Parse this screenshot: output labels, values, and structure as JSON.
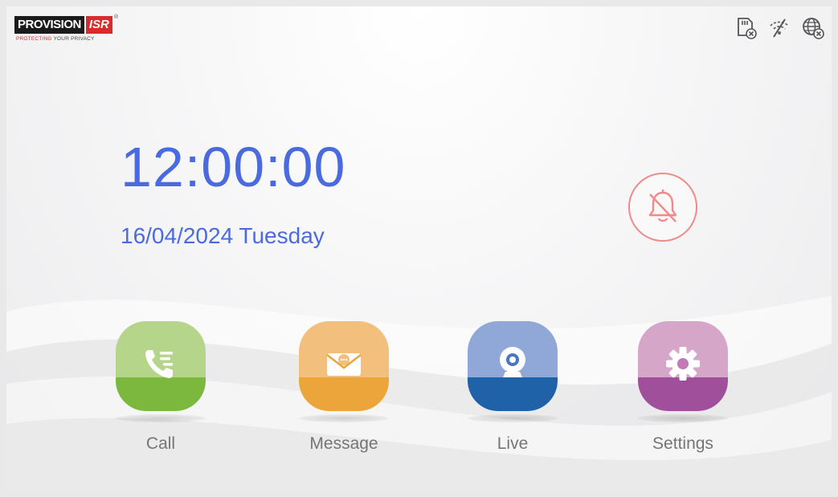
{
  "brand": {
    "name": "PROVISION",
    "suffix": "ISR",
    "registered": "®",
    "tagline_red": "PROTECTING",
    "tagline_dark": "YOUR PRIVACY"
  },
  "status_icons": [
    "sd-card-error-icon",
    "wifi-off-icon",
    "network-error-icon"
  ],
  "clock": {
    "time": "12:00:00",
    "date": "16/04/2024 Tuesday"
  },
  "mute_icon": "bell-off-icon",
  "apps": [
    {
      "label": "Call",
      "icon": "phone-icon",
      "top_color": "#b5d68a",
      "bottom_color": "#7cb83e"
    },
    {
      "label": "Message",
      "icon": "envelope-icon",
      "top_color": "#f2c07c",
      "bottom_color": "#eba53a"
    },
    {
      "label": "Live",
      "icon": "camera-icon",
      "top_color": "#8fa8d8",
      "bottom_color": "#1f62a8"
    },
    {
      "label": "Settings",
      "icon": "gear-icon",
      "top_color": "#d6a6c8",
      "bottom_color": "#a0509a"
    }
  ],
  "colors": {
    "accent": "#4a6ae0",
    "alert": "#f08a8a"
  }
}
